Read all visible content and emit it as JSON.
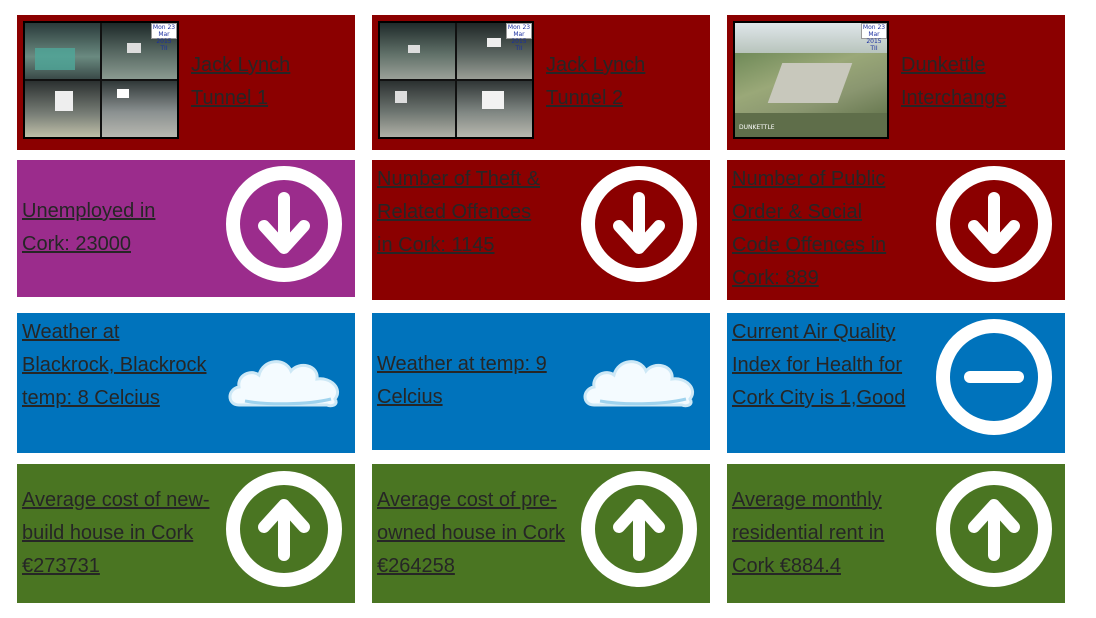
{
  "colors": {
    "red": "#8b0000",
    "purple": "#9b2c8c",
    "blue": "#0073bc",
    "green": "#4a7522",
    "white": "#ffffff"
  },
  "cameras": [
    {
      "label": "Jack Lynch Tunnel 1",
      "badge": "Mon 23 Mar 2015 TII"
    },
    {
      "label": "Jack Lynch Tunnel 2",
      "badge": "Mon 23 Mar 2015 TII"
    },
    {
      "label": "Dunkettle Interchange",
      "badge": "Mon 23 Mar 2015 TII",
      "overlay": "DUNKETTLE"
    }
  ],
  "stats": [
    {
      "label": "Unemployed in Cork: 23000",
      "icon": "arrow-down-icon"
    },
    {
      "label": "Number of Theft & Related Offences in Cork: 1145",
      "icon": "arrow-down-icon"
    },
    {
      "label": "Number of Public Order & Social Code Offences in Cork: 889",
      "icon": "arrow-down-icon"
    }
  ],
  "env": [
    {
      "label": "Weather at Blackrock, Blackrock temp: 8 Celcius",
      "icon": "cloud-icon"
    },
    {
      "label": "Weather at temp: 9 Celcius",
      "icon": "cloud-icon"
    },
    {
      "label": "Current Air Quality Index for Health for Cork City is 1,Good",
      "icon": "minus-icon"
    }
  ],
  "housing": [
    {
      "label": "Average cost of new-build house in Cork €273731",
      "icon": "arrow-up-icon"
    },
    {
      "label": "Average cost of pre-owned house in Cork €264258",
      "icon": "arrow-up-icon"
    },
    {
      "label": "Average monthly residential rent in Cork €884.4",
      "icon": "arrow-up-icon"
    }
  ]
}
